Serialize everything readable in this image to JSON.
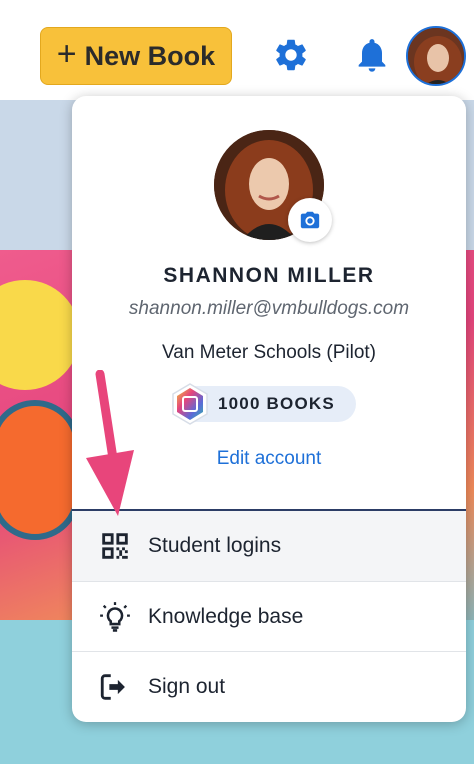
{
  "topbar": {
    "new_book_plus": "+",
    "new_book_label": "New Book",
    "icons": [
      "gear-icon",
      "bell-icon",
      "avatar"
    ]
  },
  "profile": {
    "name": "SHANNON MILLER",
    "email": "shannon.miller@vmbulldogs.com",
    "school": "Van Meter Schools (Pilot)",
    "books_badge": "1000 BOOKS",
    "edit_account": "Edit account"
  },
  "menu": {
    "items": [
      {
        "label": "Student logins",
        "icon": "qr-code-icon"
      },
      {
        "label": "Knowledge base",
        "icon": "lightbulb-icon"
      },
      {
        "label": "Sign out",
        "icon": "sign-out-icon"
      }
    ]
  },
  "colors": {
    "accent_button": "#f8c13a",
    "brand_blue": "#1e70d8",
    "annotation_arrow": "#e8457b"
  }
}
